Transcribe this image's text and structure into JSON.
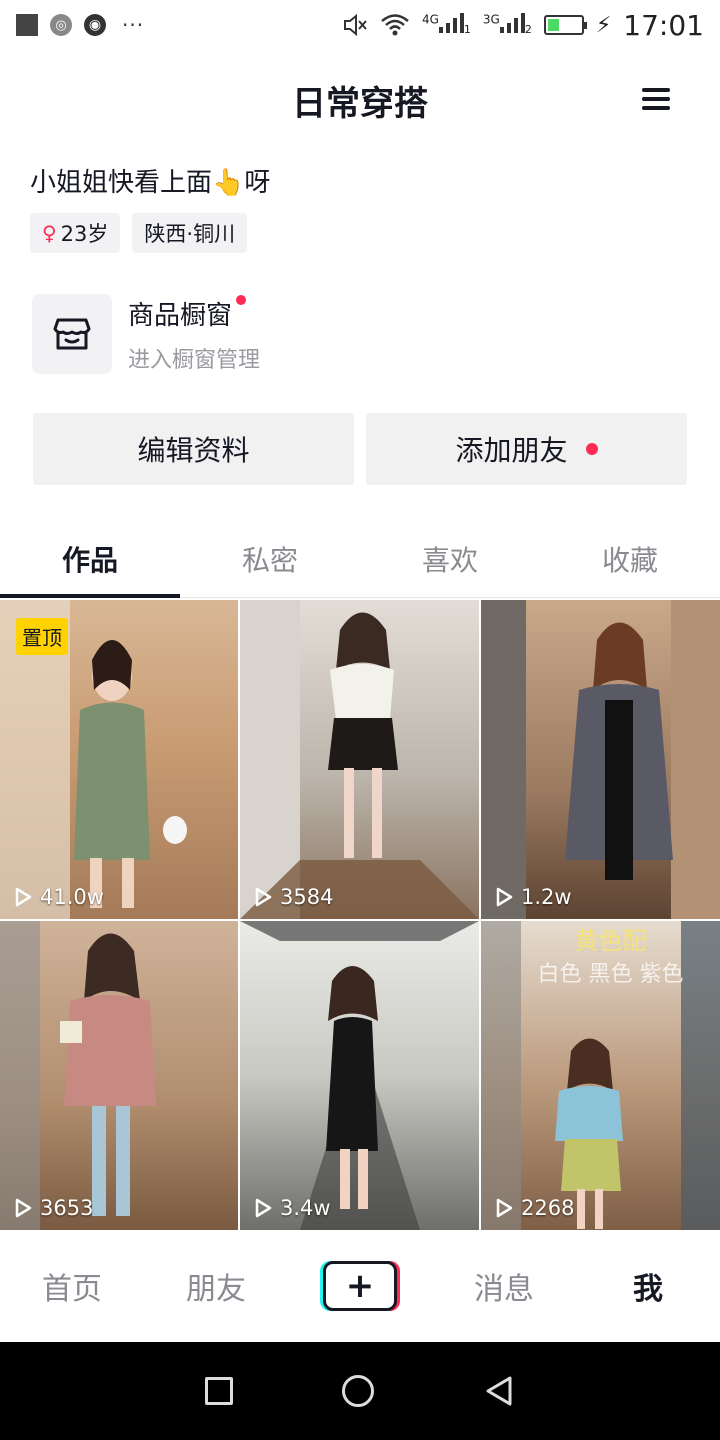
{
  "status_bar": {
    "net1": "4G",
    "sim1": "1",
    "net2": "3G",
    "sim2": "2",
    "time": "17:01",
    "battery_level": 0.3
  },
  "header": {
    "title": "日常穿搭"
  },
  "profile": {
    "bio": "小姐姐快看上面👆呀",
    "age_tag": "23岁",
    "location_tag": "陕西·铜川"
  },
  "shop_window": {
    "title": "商品橱窗",
    "subtitle": "进入橱窗管理"
  },
  "actions": {
    "edit_label": "编辑资料",
    "add_friend_label": "添加朋友"
  },
  "tabs": [
    {
      "label": "作品",
      "active": true
    },
    {
      "label": "私密",
      "active": false
    },
    {
      "label": "喜欢",
      "active": false
    },
    {
      "label": "收藏",
      "active": false
    }
  ],
  "videos": [
    {
      "pinned_label": "置顶",
      "plays": "41.0w"
    },
    {
      "plays": "3584"
    },
    {
      "plays": "1.2w"
    },
    {
      "plays": "3653"
    },
    {
      "plays": "3.4w"
    },
    {
      "plays": "2268",
      "overlay_line1": "黄色配",
      "overlay_line2": "白色 黑色 紫色"
    }
  ],
  "bottom_nav": {
    "home": "首页",
    "friends": "朋友",
    "plus": "+",
    "messages": "消息",
    "me": "我"
  },
  "colors": {
    "accent": "#fe2c55",
    "pin": "#ffd200",
    "text": "#161823"
  }
}
